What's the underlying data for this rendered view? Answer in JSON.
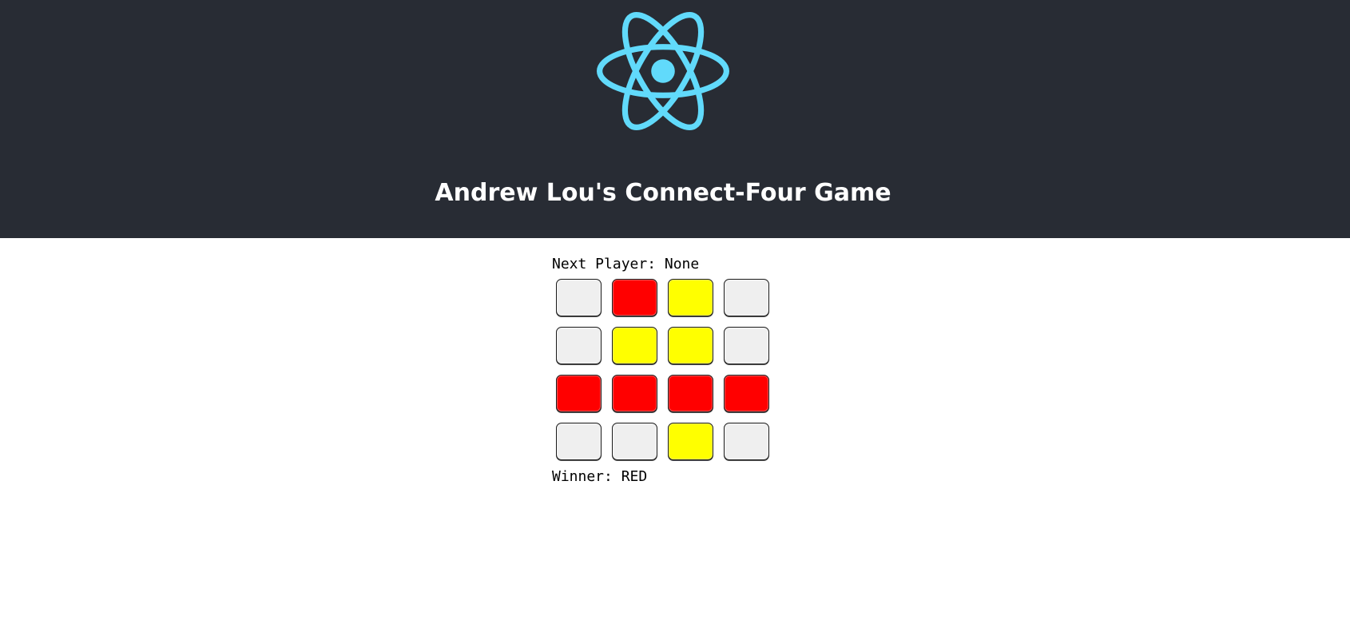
{
  "header": {
    "title": "Andrew Lou's Connect-Four Game",
    "logo_icon": "react-atom-icon",
    "background": "#282c34",
    "logo_color": "#61dafb"
  },
  "game": {
    "next_player_label": "Next Player: None",
    "winner_label": "Winner: RED",
    "colors": {
      "empty": "#efefef",
      "red": "#ff0000",
      "yellow": "#ffff00"
    },
    "board": [
      [
        "empty",
        "red",
        "yellow",
        "empty"
      ],
      [
        "empty",
        "yellow",
        "yellow",
        "empty"
      ],
      [
        "red",
        "red",
        "red",
        "red"
      ],
      [
        "empty",
        "empty",
        "yellow",
        "empty"
      ]
    ]
  }
}
